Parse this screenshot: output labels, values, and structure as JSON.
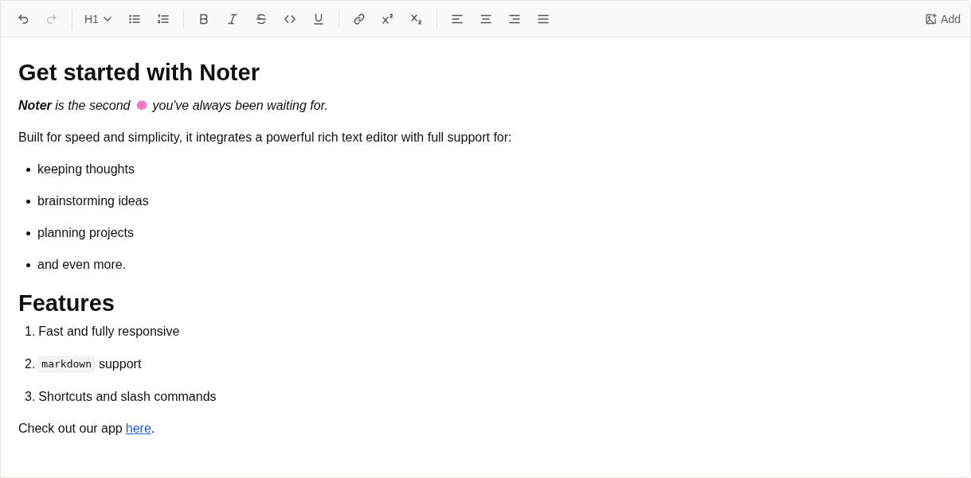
{
  "toolbar": {
    "groups": [
      [
        {
          "kind": "undo",
          "disabled": false
        },
        {
          "kind": "redo",
          "disabled": true
        }
      ],
      [
        {
          "kind": "heading",
          "label": "H1"
        },
        {
          "kind": "bullet-list"
        },
        {
          "kind": "ordered-list"
        }
      ],
      [
        {
          "kind": "bold"
        },
        {
          "kind": "italic"
        },
        {
          "kind": "strike"
        },
        {
          "kind": "code"
        },
        {
          "kind": "underline"
        }
      ],
      [
        {
          "kind": "link"
        },
        {
          "kind": "superscript"
        },
        {
          "kind": "subscript"
        }
      ],
      [
        {
          "kind": "align-left"
        },
        {
          "kind": "align-center"
        },
        {
          "kind": "align-right"
        },
        {
          "kind": "align-justify"
        }
      ]
    ],
    "add_button": {
      "label": "Add"
    }
  },
  "document": {
    "title": "Get started with Noter",
    "intro": {
      "before": "**Noter** is the second",
      "after": "you've always been waiting for."
    },
    "description": "Built for speed and simplicity, it integrates a powerful rich text editor with full support for:",
    "bullets": [
      "keeping thoughts",
      "brainstorming ideas",
      "planning projects",
      "and even more."
    ],
    "features_heading": "Features",
    "features": [
      {
        "number": "1.",
        "parts": [
          {
            "kind": "text",
            "text": "Fast and fully responsive"
          }
        ]
      },
      {
        "number": "2.",
        "parts": [
          {
            "kind": "code",
            "text": "markdown"
          },
          {
            "kind": "text",
            "text": "support"
          }
        ]
      },
      {
        "number": "3.",
        "parts": [
          {
            "kind": "text",
            "text": "Shortcuts and slash commands"
          }
        ]
      }
    ],
    "footer": {
      "before": "Check out our app",
      "link": "here",
      "after": "."
    }
  }
}
